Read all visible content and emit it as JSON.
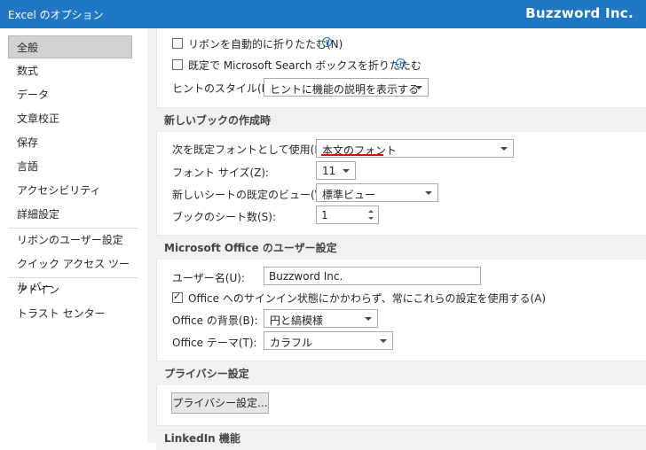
{
  "window": {
    "title": "Excel のオプション",
    "brand": "Buzzword Inc."
  },
  "sidebar": {
    "items": [
      "全般",
      "数式",
      "データ",
      "文章校正",
      "保存",
      "言語",
      "アクセシビリティ",
      "詳細設定",
      "リボンのユーザー設定",
      "クイック アクセス ツール バー",
      "アドイン",
      "トラスト センター"
    ],
    "selected": "全般"
  },
  "top": {
    "collapse_ribbon": "リボンを自動的に折りたたむ(N)",
    "collapse_search": "既定で Microsoft Search ボックスを折りたたむ",
    "tooltip_label": "ヒントのスタイル(R):",
    "tooltip_value": "ヒントに機能の説明を表示する"
  },
  "new_book": {
    "header": "新しいブックの作成時",
    "font_label": "次を既定フォントとして使用(N):",
    "font_value": "本文のフォント",
    "size_label": "フォント サイズ(Z):",
    "size_value": "11",
    "view_label": "新しいシートの既定のビュー(V):",
    "view_value": "標準ビュー",
    "sheets_label": "ブックのシート数(S):",
    "sheets_value": "1"
  },
  "office_user": {
    "header": "Microsoft Office のユーザー設定",
    "username_label": "ユーザー名(U):",
    "username_value": "Buzzword Inc.",
    "always_use": "Office へのサインイン状態にかかわらず、常にこれらの設定を使用する(A)",
    "background_label": "Office の背景(B):",
    "background_value": "円と縞模様",
    "theme_label": "Office テーマ(T):",
    "theme_value": "カラフル"
  },
  "privacy": {
    "header": "プライバシー設定",
    "button": "プライバシー設定..."
  },
  "linkedin": {
    "header": "LinkedIn 機能"
  },
  "colors": {
    "titlebar": "#1f76c2",
    "underline": "#d01010"
  }
}
